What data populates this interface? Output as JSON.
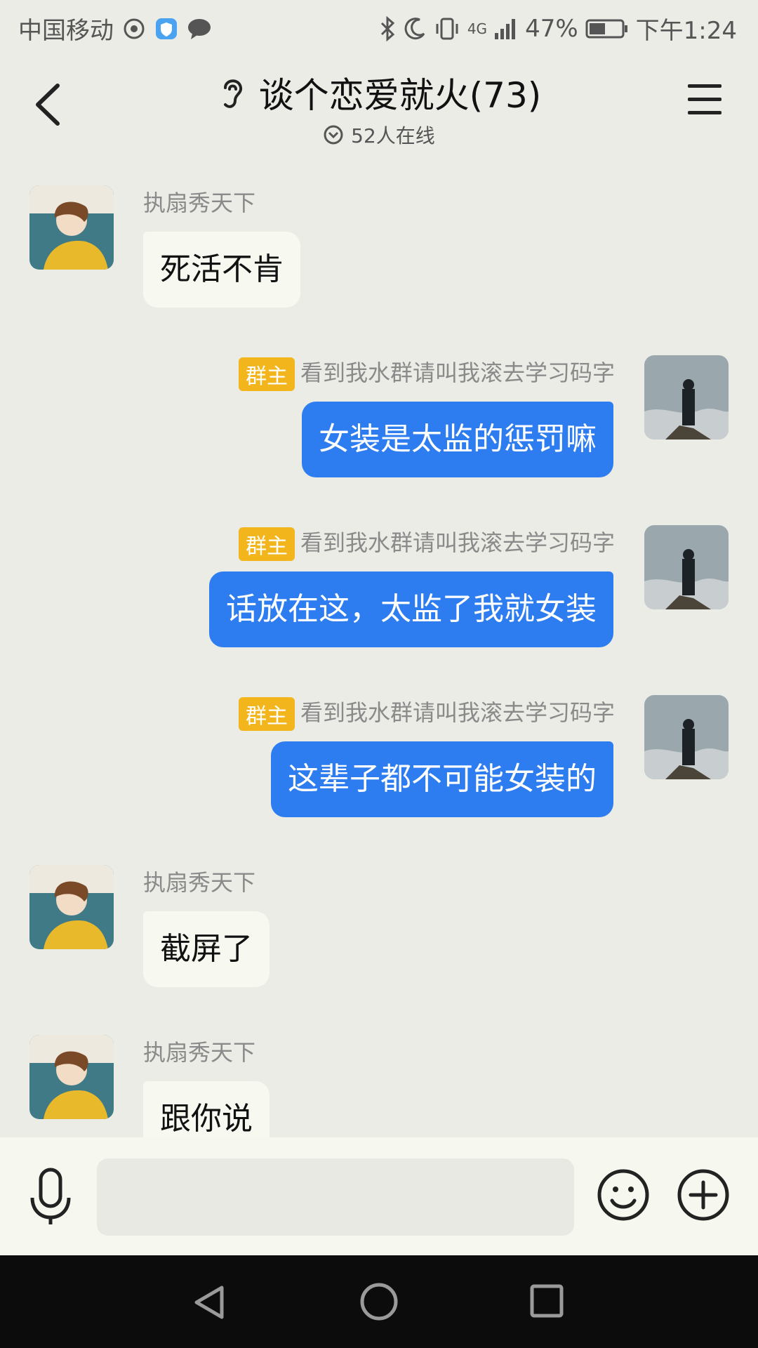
{
  "status_bar": {
    "carrier": "中国移动",
    "network": "4G",
    "battery": "47%",
    "time": "下午1:24"
  },
  "header": {
    "title": "谈个恋爱就火(73)",
    "online": "52人在线"
  },
  "messages": [
    {
      "side": "in",
      "sender": "执扇秀天下",
      "text": "死活不肯"
    },
    {
      "side": "out",
      "badge": "群主",
      "sender": "看到我水群请叫我滚去学习码字",
      "text": "女装是太监的惩罚嘛"
    },
    {
      "side": "out",
      "badge": "群主",
      "sender": "看到我水群请叫我滚去学习码字",
      "text": "话放在这，太监了我就女装"
    },
    {
      "side": "out",
      "badge": "群主",
      "sender": "看到我水群请叫我滚去学习码字",
      "text": "这辈子都不可能女装的"
    },
    {
      "side": "in",
      "sender": "执扇秀天下",
      "text": "截屏了"
    },
    {
      "side": "in",
      "sender": "执扇秀天下",
      "text": "跟你说"
    }
  ],
  "input": {
    "placeholder": ""
  },
  "colors": {
    "background": "#ebece6",
    "outgoing_bubble": "#2d7df0",
    "incoming_bubble": "#f7f8f0",
    "owner_badge": "#f2b51b"
  }
}
